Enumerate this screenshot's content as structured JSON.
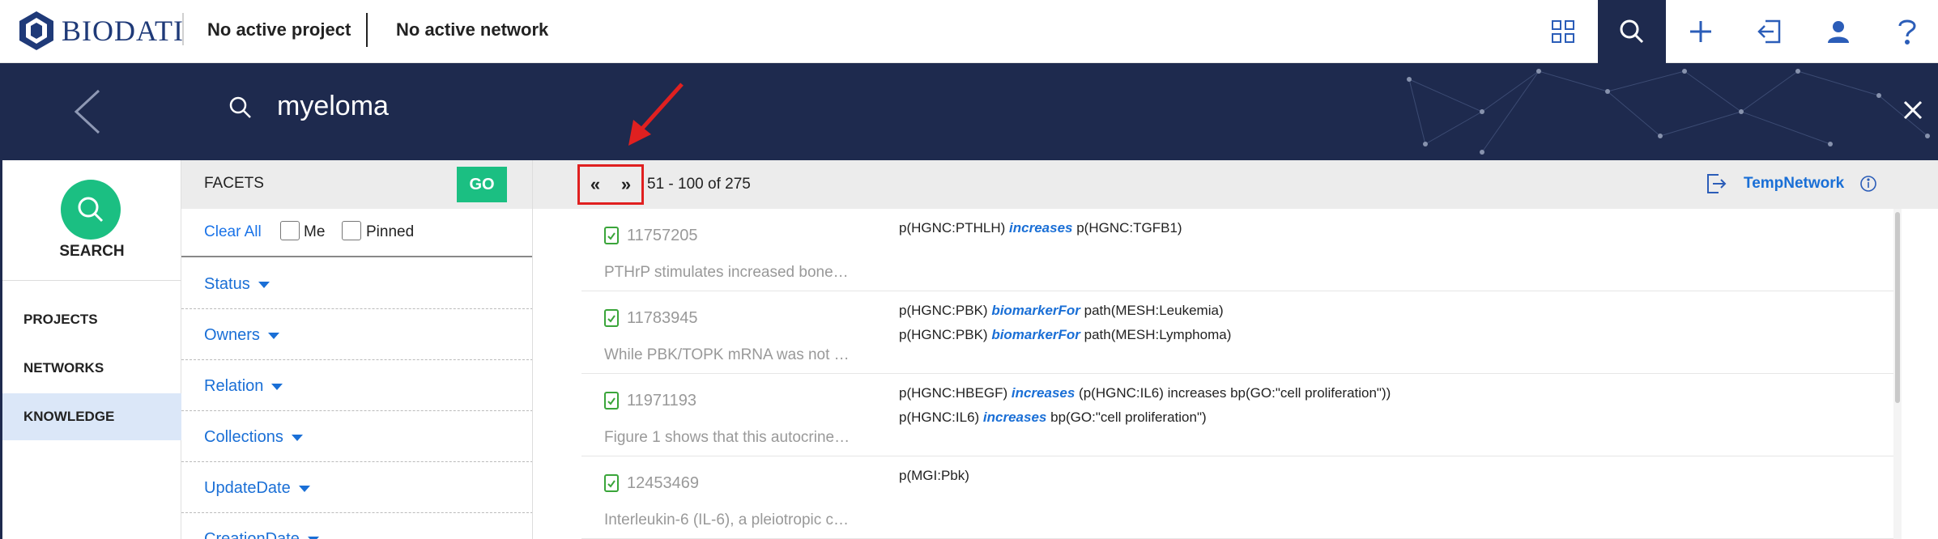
{
  "header": {
    "logo_text": "BIODATI",
    "project": "No active project",
    "network": "No active network",
    "icons": [
      "grid-icon",
      "search-icon",
      "plus-icon",
      "import-icon",
      "user-icon",
      "help-icon"
    ]
  },
  "search": {
    "query": "myeloma"
  },
  "leftnav": {
    "search_label": "SEARCH",
    "items": [
      {
        "label": "PROJECTS"
      },
      {
        "label": "NETWORKS"
      },
      {
        "label": "KNOWLEDGE"
      }
    ]
  },
  "facets": {
    "title": "FACETS",
    "go_label": "GO",
    "clear_all": "Clear All",
    "me_label": "Me",
    "pinned_label": "Pinned",
    "groups": [
      "Status",
      "Owners",
      "Relation",
      "Collections",
      "UpdateDate",
      "CreationDate"
    ]
  },
  "results_bar": {
    "prev": "«",
    "next": "»",
    "range": "51 - 100 of 275",
    "network_name": "TempNetwork"
  },
  "results": [
    {
      "pmid": "11757205",
      "excerpt": "PTHrP stimulates increased bone…",
      "statements": [
        {
          "subject": "p(HGNC:PTHLH)",
          "relation": "increases",
          "object": "p(HGNC:TGFB1)"
        }
      ]
    },
    {
      "pmid": "11783945",
      "excerpt": "While PBK/TOPK mRNA was not …",
      "statements": [
        {
          "subject": "p(HGNC:PBK)",
          "relation": "biomarkerFor",
          "object": "path(MESH:Leukemia)"
        },
        {
          "subject": "p(HGNC:PBK)",
          "relation": "biomarkerFor",
          "object": "path(MESH:Lymphoma)"
        }
      ]
    },
    {
      "pmid": "11971193",
      "excerpt": "Figure 1 shows that this autocrine…",
      "statements": [
        {
          "subject": "p(HGNC:HBEGF)",
          "relation": "increases",
          "object": "(p(HGNC:IL6) increases bp(GO:\"cell proliferation\"))"
        },
        {
          "subject": "p(HGNC:IL6)",
          "relation": "increases",
          "object": "bp(GO:\"cell proliferation\")"
        }
      ]
    },
    {
      "pmid": "12453469",
      "excerpt": "Interleukin-6 (IL-6), a pleiotropic c…",
      "statements": [
        {
          "subject": "p(MGI:Pbk)",
          "relation": "",
          "object": ""
        }
      ]
    }
  ],
  "colors": {
    "navy": "#1e2a4e",
    "green": "#1bbf82",
    "link_blue": "#1a6fd6",
    "highlight_red": "#e02020"
  }
}
